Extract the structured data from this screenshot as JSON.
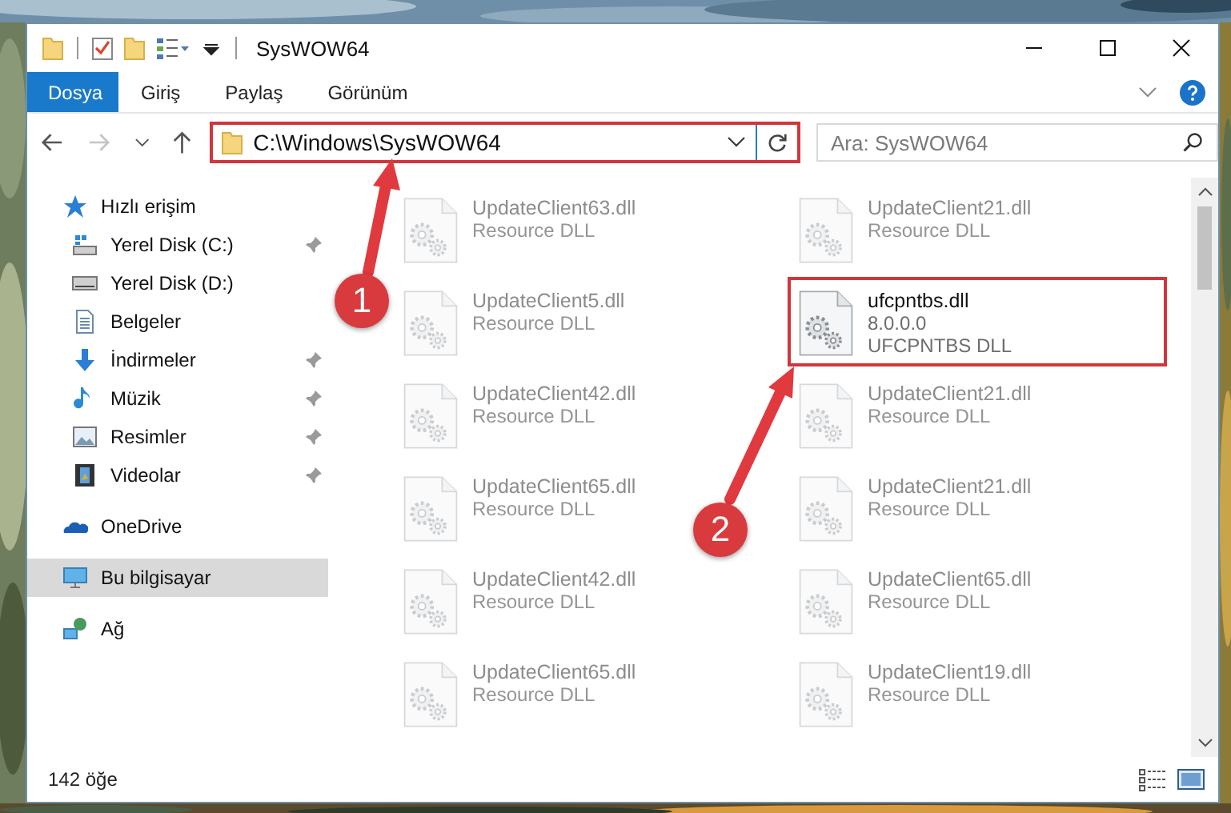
{
  "window": {
    "title": "SysWOW64"
  },
  "ribbon_tabs": [
    {
      "label": "Dosya",
      "kind": "file"
    },
    {
      "label": "Giriş",
      "kind": "tab"
    },
    {
      "label": "Paylaş",
      "kind": "tab"
    },
    {
      "label": "Görünüm",
      "kind": "tab"
    }
  ],
  "address": {
    "path": "C:\\Windows\\SysWOW64",
    "outlined": true
  },
  "search": {
    "placeholder": "Ara: SysWOW64"
  },
  "sidebar": {
    "items": [
      {
        "label": "Hızlı erişim",
        "kind": "star",
        "selected": false,
        "children": [
          {
            "label": "Yerel Disk (C:)",
            "kind": "disk-c",
            "pinned": true,
            "selected": false
          },
          {
            "label": "Yerel Disk (D:)",
            "kind": "disk",
            "pinned": false,
            "selected": false
          },
          {
            "label": "Belgeler",
            "kind": "documents",
            "pinned": false,
            "selected": false
          },
          {
            "label": "İndirmeler",
            "kind": "download",
            "pinned": true,
            "selected": false
          },
          {
            "label": "Müzik",
            "kind": "music",
            "pinned": true,
            "selected": false
          },
          {
            "label": "Resimler",
            "kind": "pictures",
            "pinned": true,
            "selected": false
          },
          {
            "label": "Videolar",
            "kind": "videos",
            "pinned": true,
            "selected": false
          }
        ]
      },
      {
        "label": "OneDrive",
        "kind": "cloud",
        "selected": false
      },
      {
        "label": "Bu bilgisayar",
        "kind": "computer",
        "selected": true
      },
      {
        "label": "Ağ",
        "kind": "network",
        "selected": false
      }
    ]
  },
  "files": [
    {
      "name": "UpdateClient63.dll",
      "type": "Resource DLL",
      "dimmed": true,
      "outlined": false
    },
    {
      "name": "UpdateClient21.dll",
      "type": "Resource DLL",
      "dimmed": true,
      "outlined": false
    },
    {
      "name": "UpdateClient5.dll",
      "type": "Resource DLL",
      "dimmed": true,
      "outlined": false
    },
    {
      "name": "ufcpntbs.dll",
      "version": "8.0.0.0",
      "type": "UFCPNTBS DLL",
      "dimmed": false,
      "outlined": true
    },
    {
      "name": "UpdateClient42.dll",
      "type": "Resource DLL",
      "dimmed": true,
      "outlined": false
    },
    {
      "name": "UpdateClient21.dll",
      "type": "Resource DLL",
      "dimmed": true,
      "outlined": false
    },
    {
      "name": "UpdateClient65.dll",
      "type": "Resource DLL",
      "dimmed": true,
      "outlined": false
    },
    {
      "name": "UpdateClient21.dll",
      "type": "Resource DLL",
      "dimmed": true,
      "outlined": false
    },
    {
      "name": "UpdateClient42.dll",
      "type": "Resource DLL",
      "dimmed": true,
      "outlined": false
    },
    {
      "name": "UpdateClient65.dll",
      "type": "Resource DLL",
      "dimmed": true,
      "outlined": false
    },
    {
      "name": "UpdateClient65.dll",
      "type": "Resource DLL",
      "dimmed": true,
      "outlined": false
    },
    {
      "name": "UpdateClient19.dll",
      "type": "Resource DLL",
      "dimmed": true,
      "outlined": false
    }
  ],
  "annotations": [
    {
      "label": "1"
    },
    {
      "label": "2"
    }
  ],
  "status_bar": {
    "item_count": "142 öğe"
  }
}
